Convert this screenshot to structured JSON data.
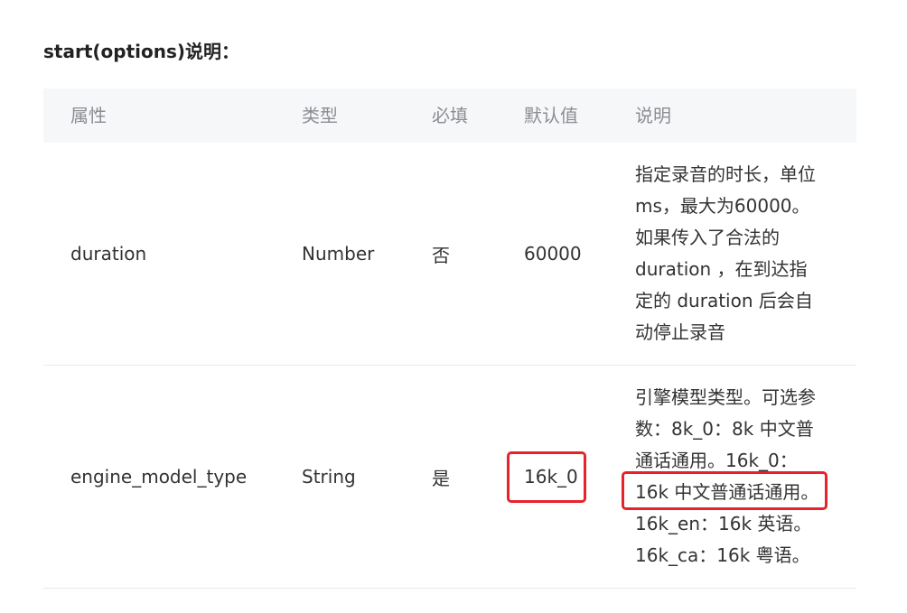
{
  "section_title": "start(options)说明：",
  "table": {
    "headers": [
      "属性",
      "类型",
      "必填",
      "默认值",
      "说明"
    ],
    "rows": [
      {
        "name": "duration",
        "type": "Number",
        "required": "否",
        "default": "60000",
        "description_lines": [
          "指定录音的时长，单位",
          "ms，最大为60000。",
          "如果传入了合法的",
          "duration ，在到达指",
          "定的 duration 后会自",
          "动停止录音"
        ]
      },
      {
        "name": "engine_model_type",
        "type": "String",
        "required": "是",
        "default": "16k_0",
        "description_lines": [
          "引擎模型类型。可选参",
          "数：8k_0：8k 中文普",
          "通话通用。16k_0：",
          "16k 中文普通话通用。",
          "16k_en：16k 英语。",
          "16k_ca：16k 粤语。"
        ]
      }
    ]
  },
  "colors": {
    "highlight": "#e8222a",
    "header_bg": "#f6f7f9"
  }
}
